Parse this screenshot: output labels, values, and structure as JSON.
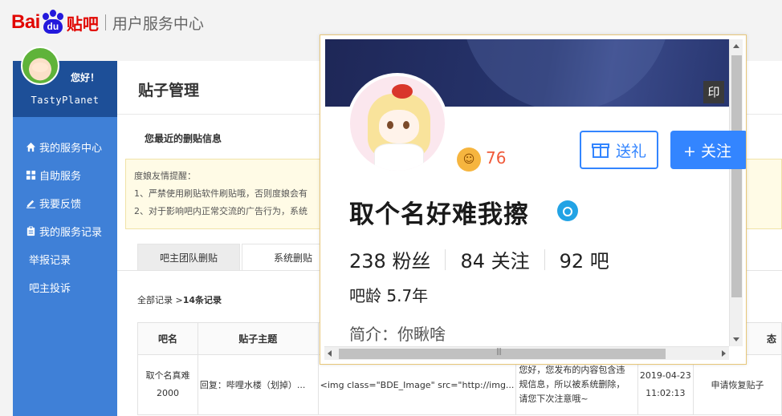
{
  "header": {
    "logo_bai": "Bai",
    "logo_du": "du",
    "logo_tieba": "贴吧",
    "center_title": "用户服务中心"
  },
  "sidebar": {
    "greeting": "您好！",
    "username": "TastyPlanet",
    "items": [
      {
        "label": "我的服务中心",
        "icon": "home-icon"
      },
      {
        "label": "自助服务",
        "icon": "grid-icon"
      },
      {
        "label": "我要反馈",
        "icon": "pencil-icon"
      },
      {
        "label": "我的服务记录",
        "icon": "clipboard-icon"
      },
      {
        "label": "举报记录"
      },
      {
        "label": "吧主投诉"
      }
    ]
  },
  "main": {
    "page_title": "贴子管理",
    "recent_label": "您最近的删贴信息",
    "notice": {
      "title": "度娘友情提醒：",
      "line1": "1、严禁使用刷贴软件刷贴哦，否则度娘会有",
      "line2": "2、对于影响吧内正常交流的广告行为，系统"
    },
    "tabs": [
      "吧主团队删贴",
      "系统删贴"
    ],
    "records": {
      "prefix": "全部记录 >",
      "count": "14条记录"
    },
    "table": {
      "headers": [
        "吧名",
        "贴子主题",
        "",
        "",
        "",
        "态"
      ],
      "row": {
        "bar_line1": "取个名真难",
        "bar_line2": "2000",
        "topic": "回复：哔哩水楼（划掉）...",
        "content": "<img class=\"BDE_Image\" src=\"http://img...",
        "reason_line1": "您好，您发布的内容包含违",
        "reason_line2": "规信息，所以被系统删除，",
        "reason_line3": "请您下次注意哦~",
        "date": "2019-04-23",
        "time": "11:02:13",
        "action": "申请恢复贴子"
      }
    }
  },
  "popup": {
    "stamp": "印",
    "level": "76",
    "gift_label": "送礼",
    "follow_label": "+ 关注",
    "name": "取个名好难我擦",
    "stats": {
      "fans": "238 粉丝",
      "following": "84 关注",
      "bars": "92 吧"
    },
    "age": "吧龄 5.7年",
    "intro": "简介：你瞅啥"
  },
  "colors": {
    "sidebar": "#3f80d7",
    "sidebar_userbox": "#1d4f98",
    "link": "#3385ff",
    "brand_red": "#e10601",
    "brand_blue": "#2319dc",
    "level": "#f05a3a"
  }
}
